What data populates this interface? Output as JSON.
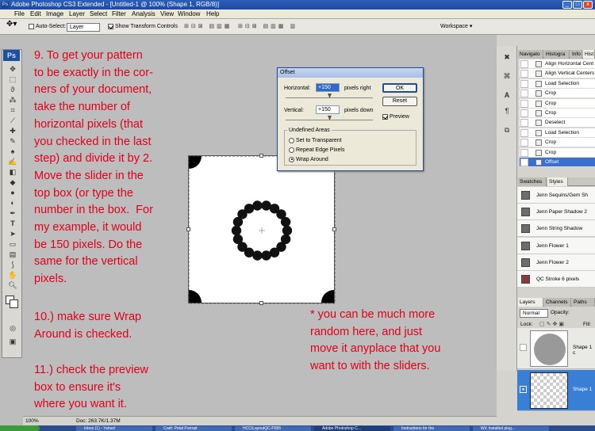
{
  "window": {
    "title": "Adobe Photoshop CS3 Extended - [Untitled-1 @ 100% (Shape 1, RGB/8)]",
    "app_icon": "Ps",
    "min": "_",
    "max": "□",
    "close": "x"
  },
  "menu": [
    "File",
    "Edit",
    "Image",
    "Layer",
    "Select",
    "Filter",
    "Analysis",
    "View",
    "Window",
    "Help"
  ],
  "options": {
    "auto_select_label": "Auto-Select:",
    "auto_select_value": "Layer",
    "show_transform": "Show Transform Controls",
    "workspace": "Workspace ▾"
  },
  "toolbox": {
    "logo": "Ps"
  },
  "tutorial": {
    "step9": "9. To get your pattern\nto be exactly in the cor-\nners of your document,\ntake the number of\nhorizontal pixels (that\nyou checked in the last\nstep) and divide it by 2.\nMove the slider in the\ntop box (or type the\nnumber in the box.  For\nmy example, it would\nbe 150 pixels. Do the\nsame for the vertical\npixels.",
    "step10": "10.) make sure Wrap\nAround is checked.",
    "step11": "11.) check the preview\nbox to ensure it's\nwhere you want it.",
    "note": "* you can be much more\nrandom here, and just\nmove it anyplace that you\nwant to with the sliders."
  },
  "dialog": {
    "title": "Offset",
    "horizontal_label": "Horizontal:",
    "horizontal_value": "+150",
    "horizontal_unit": "pixels right",
    "vertical_label": "Vertical:",
    "vertical_value": "+150",
    "vertical_unit": "pixels down",
    "ok": "OK",
    "reset": "Reset",
    "preview": "Preview",
    "undefined_areas": "Undefined Areas",
    "options": [
      "Set to Transparent",
      "Repeat Edge Pixels",
      "Wrap Around"
    ],
    "selected_option": "Wrap Around"
  },
  "panels": {
    "top_tabs": [
      "Navigato",
      "Histogra",
      "Info",
      "Hist"
    ],
    "history": [
      "Align Horizontal Cent",
      "Align Vertical Centers",
      "Load Selection",
      "Crop",
      "Crop",
      "Crop",
      "Deselect",
      "Load Selection",
      "Crop",
      "Crop",
      "Offset"
    ],
    "styles_tabs": [
      "Swatches",
      "Styles"
    ],
    "styles": [
      "Jenn Sequins/Gem Sh",
      "Jenn Paper Shadow 2",
      "Jenn String Shadow",
      "Jenn Flower 1",
      "Jenn Flower 2",
      "QC Stroke 6 pixels"
    ],
    "layers_tabs": [
      "Layers",
      "Channels",
      "Paths"
    ],
    "blend_mode": "Normal",
    "opacity_label": "Opacity:",
    "lock_label": "Lock:",
    "fill_label": "Fill:",
    "layers": [
      "Shape 1 c",
      "Shape 1"
    ]
  },
  "status": {
    "zoom": "100%",
    "doc": "Doc: 263.7K/1.37M"
  },
  "taskbar": [
    "Inbox (1) - Yahoo!",
    "Craft: Petal Portrait",
    "HCC/LayoutQC-P055",
    "Adobe Photoshop C...",
    "Instructions for the",
    "WX Installed plug..."
  ]
}
